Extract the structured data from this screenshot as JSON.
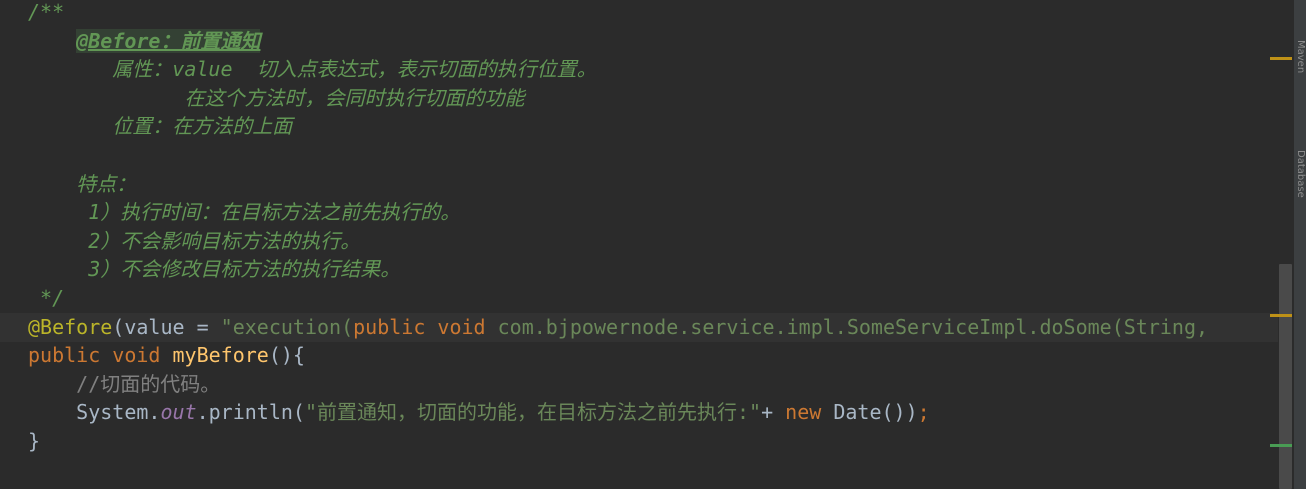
{
  "editor": {
    "lines": [
      {
        "parts": [
          {
            "c": "doc",
            "t": "/**"
          }
        ]
      },
      {
        "parts": [
          {
            "c": "doc",
            "t": "    "
          },
          {
            "c": "doc-tag",
            "t": "@Before：前置通知"
          }
        ]
      },
      {
        "parts": [
          {
            "c": "doc",
            "t": "       属性：value  切入点表达式，表示切面的执行位置。"
          }
        ]
      },
      {
        "parts": [
          {
            "c": "doc",
            "t": "             在这个方法时，会同时执行切面的功能"
          }
        ]
      },
      {
        "parts": [
          {
            "c": "doc",
            "t": "       位置：在方法的上面"
          }
        ]
      },
      {
        "parts": []
      },
      {
        "parts": [
          {
            "c": "doc",
            "t": "    特点："
          }
        ]
      },
      {
        "parts": [
          {
            "c": "doc",
            "t": "     1）执行时间：在目标方法之前先执行的。"
          }
        ]
      },
      {
        "parts": [
          {
            "c": "doc",
            "t": "     2）不会影响目标方法的执行。"
          }
        ]
      },
      {
        "parts": [
          {
            "c": "doc",
            "t": "     3）不会修改目标方法的执行结果。"
          }
        ]
      },
      {
        "parts": [
          {
            "c": "doc",
            "t": " */"
          }
        ]
      },
      {
        "current": true,
        "parts": [
          {
            "c": "ann",
            "t": "@Before"
          },
          {
            "c": "txt",
            "t": "(value = "
          },
          {
            "c": "str",
            "t": "\"execution("
          },
          {
            "c": "kw",
            "t": "public void "
          },
          {
            "c": "str",
            "t": "com.bjpowernode.service.impl.SomeServiceImpl.doSome(String,"
          }
        ]
      },
      {
        "parts": [
          {
            "c": "kw",
            "t": "public void "
          },
          {
            "c": "fn",
            "t": "myBefore"
          },
          {
            "c": "txt",
            "t": "(){"
          }
        ]
      },
      {
        "parts": [
          {
            "c": "cmt",
            "t": "    //切面的代码。"
          }
        ]
      },
      {
        "parts": [
          {
            "c": "txt",
            "t": "    System."
          },
          {
            "c": "fld",
            "t": "out"
          },
          {
            "c": "txt",
            "t": ".println("
          },
          {
            "c": "str",
            "t": "\"前置通知，切面的功能，在目标方法之前先执行:\""
          },
          {
            "c": "txt",
            "t": "+ "
          },
          {
            "c": "kw",
            "t": "new "
          },
          {
            "c": "txt",
            "t": "Date())"
          },
          {
            "c": "kw",
            "t": ";"
          }
        ]
      },
      {
        "parts": [
          {
            "c": "txt",
            "t": "}"
          }
        ]
      }
    ]
  },
  "side_panel": {
    "labels": [
      "Maven",
      "Database"
    ]
  },
  "colors": {
    "background": "#2b2b2b",
    "current_line": "#323232",
    "doc_comment": "#629755",
    "keyword": "#cc7832",
    "string": "#6a8759",
    "annotation": "#bbb529",
    "method": "#ffc66d",
    "marker_warning": "#be9117",
    "marker_ok": "#499c54"
  }
}
